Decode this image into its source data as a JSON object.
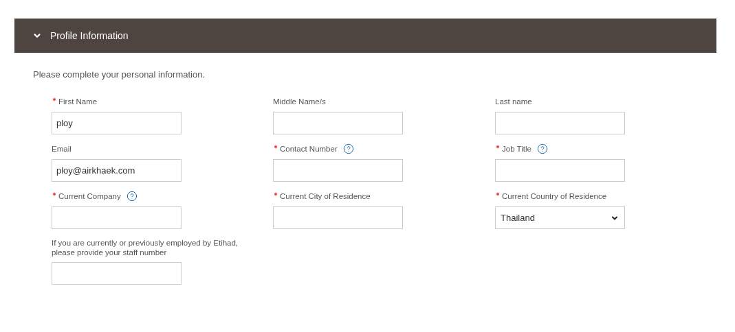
{
  "section": {
    "title": "Profile Information",
    "expanded": true
  },
  "intro": "Please complete your personal information.",
  "fields": [
    {
      "label": "First Name",
      "required": true,
      "help": false,
      "kind": "text",
      "value": "ploy"
    },
    {
      "label": "Middle Name/s",
      "required": false,
      "help": false,
      "kind": "text"
    },
    {
      "label": "Last name",
      "required": false,
      "help": false,
      "kind": "text"
    },
    {
      "label": "Email",
      "required": false,
      "help": false,
      "kind": "text",
      "value": "ploy@airkhaek.com"
    },
    {
      "label": "Contact Number",
      "required": true,
      "help": true,
      "kind": "text"
    },
    {
      "label": "Job Title",
      "required": true,
      "help": true,
      "kind": "text"
    },
    {
      "label": "Current Company",
      "required": true,
      "help": true,
      "kind": "text"
    },
    {
      "label": "Current City of Residence",
      "required": true,
      "help": false,
      "kind": "text"
    },
    {
      "label": "Current Country of Residence",
      "required": true,
      "help": false,
      "kind": "select",
      "value": "Thailand"
    },
    {
      "label": "If you are currently or previously employed by Etihad, please provide your staff number",
      "required": false,
      "help": false,
      "kind": "text"
    }
  ]
}
